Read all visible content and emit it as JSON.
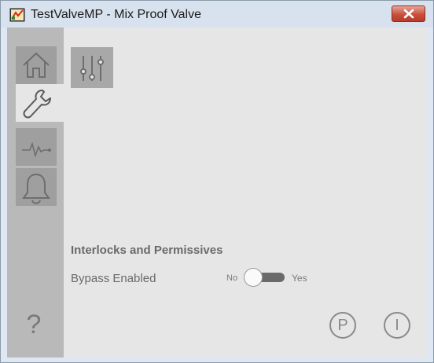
{
  "window": {
    "title": "TestValveMP - Mix Proof Valve",
    "close_button": "close",
    "colors": {
      "titlebar": "#d8e2ee",
      "close": "#c8503b",
      "sidebar": "#b9b9b9"
    }
  },
  "sidebar": {
    "items": [
      {
        "name": "home",
        "icon": "home-icon"
      },
      {
        "name": "maintenance",
        "icon": "wrench-icon",
        "selected": true
      },
      {
        "name": "trends",
        "icon": "pulse-icon"
      },
      {
        "name": "alarms",
        "icon": "bell-icon"
      }
    ],
    "help": "?"
  },
  "toolbar": {
    "button_icon": "sliders-icon"
  },
  "interlocks": {
    "heading": "Interlocks and Permissives",
    "bypass_label": "Bypass Enabled",
    "off_label": "No",
    "on_label": "Yes",
    "bypass_enabled": false
  },
  "badges": {
    "p": "P",
    "i": "I"
  }
}
